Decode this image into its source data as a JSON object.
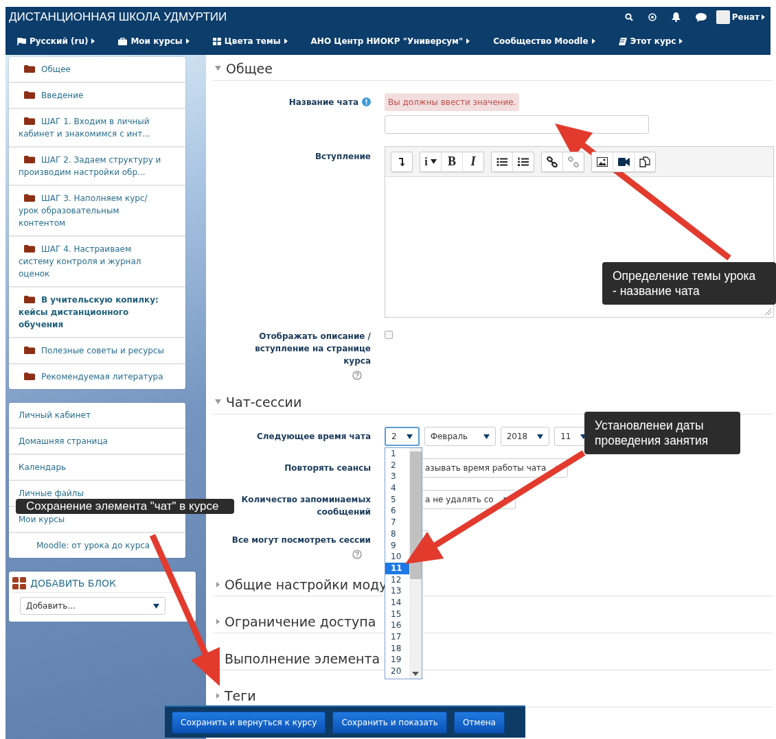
{
  "header": {
    "site_name": "ДИСТАНЦИОННАЯ ШКОЛА УДМУРТИИ",
    "user_name": "Ренат",
    "menu": [
      {
        "label": "Русский (ru)",
        "kind": "language"
      },
      {
        "label": "Мои курсы",
        "kind": "courses"
      },
      {
        "label": "Цвета темы",
        "kind": "theme"
      },
      {
        "label": "АНО Центр НИОКР \"Универсум\"",
        "kind": "custom"
      },
      {
        "label": "Сообщество Moodle",
        "kind": "custom"
      },
      {
        "label": "Этот курс",
        "kind": "course"
      }
    ]
  },
  "sections_block": {
    "items": [
      {
        "label": "Общее",
        "current": false
      },
      {
        "label": "Введение",
        "current": false
      },
      {
        "label": "ШАГ 1. Входим в личный кабинет и знакомимся с инт...",
        "current": false
      },
      {
        "label": "ШАГ 2. Задаем структуру и производим настройки обр...",
        "current": false
      },
      {
        "label": "ШАГ 3. Наполняем курс/ урок образовательным контентом",
        "current": false
      },
      {
        "label": "ШАГ 4. Настраиваем систему контроля и журнал оценок",
        "current": false
      },
      {
        "label": "В учительскую копилку: кейсы дистанционного обучения",
        "current": true
      },
      {
        "label": "Полезные советы и ресурсы",
        "current": false
      },
      {
        "label": "Рекомендуемая литература",
        "current": false
      }
    ]
  },
  "navigation_block": {
    "items": [
      {
        "label": "Личный кабинет"
      },
      {
        "label": "Домашняя страница"
      },
      {
        "label": "Календарь"
      },
      {
        "label": "Личные файлы"
      },
      {
        "label": "Мои курсы",
        "children": [
          {
            "label": "Moodle: от урока до курса"
          }
        ]
      }
    ]
  },
  "add_block": {
    "title": "ДОБАВИТЬ БЛОК",
    "select_value": "Добавить..."
  },
  "form": {
    "sections": [
      {
        "title": "Общее",
        "expanded": true,
        "fields": [
          {
            "kind": "text",
            "label": "Название чата",
            "required": true,
            "error": "Вы должны ввести значение."
          },
          {
            "kind": "editor",
            "label": "Вступление",
            "toolbar": [
              [
                {
                  "kind": "collapse"
                }
              ],
              [
                {
                  "kind": "style",
                  "label": "i"
                },
                {
                  "kind": "bold",
                  "label": "B"
                },
                {
                  "kind": "italic",
                  "label": "I"
                }
              ],
              [
                {
                  "kind": "bullets"
                },
                {
                  "kind": "numbers"
                }
              ],
              [
                {
                  "kind": "link"
                },
                {
                  "kind": "unlink"
                }
              ],
              [
                {
                  "kind": "image"
                },
                {
                  "kind": "video"
                },
                {
                  "kind": "files"
                }
              ]
            ]
          },
          {
            "kind": "checkbox",
            "label": "Отображать описание / вступление на странице курса",
            "checked": false,
            "help": true
          }
        ]
      },
      {
        "title": "Чат-сессии",
        "expanded": true,
        "fields": [
          {
            "kind": "datetime",
            "label": "Следующее время чата",
            "selects": [
              {
                "value": "2",
                "focused": true
              },
              {
                "value": "Февраль",
                "focused": false
              },
              {
                "value": "2018",
                "focused": false
              },
              {
                "value": "11",
                "focused": false
              }
            ]
          },
          {
            "kind": "select",
            "label": "Повторять сеансы",
            "value": "азывать время работы чата"
          },
          {
            "kind": "select",
            "label": "Количество запоминаемых сообщений",
            "value": "а не удалять со"
          },
          {
            "kind": "select",
            "label": "Все могут посмотреть сессии",
            "help": true
          }
        ]
      },
      {
        "title": "Общие настройки моду",
        "expanded": false
      },
      {
        "title": "Ограничение доступа",
        "expanded": false
      },
      {
        "title": "Выполнение элемента",
        "expanded": false
      },
      {
        "title": "Теги",
        "expanded": false
      }
    ]
  },
  "day_dropdown": {
    "options": [
      {
        "label": "1",
        "selected": false
      },
      {
        "label": "2",
        "selected": false
      },
      {
        "label": "3",
        "selected": false
      },
      {
        "label": "4",
        "selected": false
      },
      {
        "label": "5",
        "selected": false
      },
      {
        "label": "6",
        "selected": false
      },
      {
        "label": "7",
        "selected": false
      },
      {
        "label": "8",
        "selected": false
      },
      {
        "label": "9",
        "selected": false
      },
      {
        "label": "10",
        "selected": false
      },
      {
        "label": "11",
        "selected": true
      },
      {
        "label": "12",
        "selected": false
      },
      {
        "label": "13",
        "selected": false
      },
      {
        "label": "14",
        "selected": false
      },
      {
        "label": "15",
        "selected": false
      },
      {
        "label": "16",
        "selected": false
      },
      {
        "label": "17",
        "selected": false
      },
      {
        "label": "18",
        "selected": false
      },
      {
        "label": "19",
        "selected": false
      },
      {
        "label": "20",
        "selected": false
      }
    ]
  },
  "form_buttons": [
    "Сохранить и вернуться к курсу",
    "Сохранить и показать",
    "Отмена"
  ],
  "annotations": [
    {
      "text": "Определение темы урока\n- название чата"
    },
    {
      "text": "Установленеи даты\nпроведения занятия"
    },
    {
      "text": "Сохранение элемента \"чат\" в курсе"
    }
  ]
}
